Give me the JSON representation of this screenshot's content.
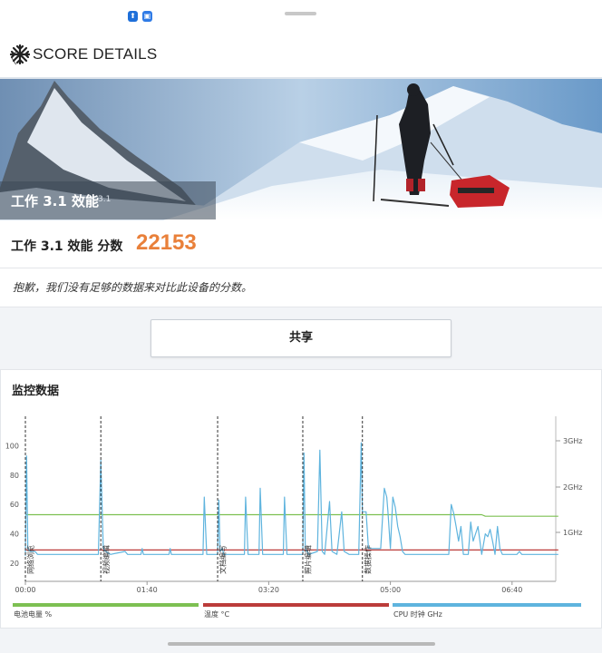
{
  "header": {
    "title": "SCORE DETAILS",
    "back_label": "〈"
  },
  "hero": {
    "benchmark": "工作 3.1 效能",
    "version": "3.1"
  },
  "score": {
    "label": "工作 3.1 效能 分数",
    "value": "22153"
  },
  "note": "抱歉，我们没有足够的数据来对比此设备的分数。",
  "share_label": "共享",
  "monitor": {
    "title": "监控数据"
  },
  "legend": {
    "battery": "电池电量 %",
    "temperature": "温度 °C",
    "cpu": "CPU 时钟 GHz"
  },
  "colors": {
    "accent": "#e9803a",
    "battery": "#7dc052",
    "temperature": "#bb3c3a",
    "cpu": "#5fb4de"
  },
  "chart_data": {
    "type": "line",
    "x_ticks": [
      "00:00",
      "01:40",
      "03:20",
      "05:00",
      "06:40"
    ],
    "x_tick_seconds": [
      0,
      100,
      200,
      300,
      400
    ],
    "y_left_ticks": [
      "20",
      "40",
      "60",
      "80",
      "100"
    ],
    "y_left_range": [
      15,
      105
    ],
    "y_right_ticks": [
      "1GHz",
      "2GHz",
      "3GHz"
    ],
    "grid": false,
    "markers": [
      {
        "t": 0,
        "label": "网络浏览"
      },
      {
        "t": 62,
        "label": "视频编辑"
      },
      {
        "t": 158,
        "label": "文档编写"
      },
      {
        "t": 228,
        "label": "照片编辑"
      },
      {
        "t": 277,
        "label": "数据操作"
      }
    ],
    "series": [
      {
        "name": "电池电量 %",
        "points": [
          [
            0,
            53
          ],
          [
            375,
            53
          ],
          [
            378,
            52
          ],
          [
            438,
            52
          ]
        ]
      },
      {
        "name": "温度 °C",
        "points": [
          [
            0,
            29
          ],
          [
            438,
            29
          ]
        ]
      },
      {
        "name": "CPU 时钟 GHz",
        "points": [
          [
            0,
            25
          ],
          [
            1,
            93
          ],
          [
            2,
            30
          ],
          [
            4,
            28
          ],
          [
            8,
            28
          ],
          [
            10,
            26
          ],
          [
            60,
            26
          ],
          [
            62,
            90
          ],
          [
            64,
            30
          ],
          [
            66,
            28
          ],
          [
            70,
            26
          ],
          [
            82,
            28
          ],
          [
            84,
            26
          ],
          [
            95,
            26
          ],
          [
            96,
            30
          ],
          [
            97,
            26
          ],
          [
            118,
            26
          ],
          [
            119,
            30
          ],
          [
            120,
            26
          ],
          [
            146,
            26
          ],
          [
            147,
            65
          ],
          [
            149,
            26
          ],
          [
            158,
            26
          ],
          [
            159,
            63
          ],
          [
            160,
            28
          ],
          [
            162,
            30
          ],
          [
            163,
            26
          ],
          [
            180,
            26
          ],
          [
            181,
            65
          ],
          [
            183,
            26
          ],
          [
            192,
            26
          ],
          [
            193,
            71
          ],
          [
            195,
            26
          ],
          [
            212,
            26
          ],
          [
            213,
            65
          ],
          [
            215,
            26
          ],
          [
            228,
            26
          ],
          [
            229,
            95
          ],
          [
            230,
            30
          ],
          [
            233,
            26
          ],
          [
            240,
            28
          ],
          [
            242,
            97
          ],
          [
            244,
            28
          ],
          [
            246,
            26
          ],
          [
            250,
            62
          ],
          [
            252,
            28
          ],
          [
            256,
            26
          ],
          [
            260,
            55
          ],
          [
            262,
            28
          ],
          [
            266,
            26
          ],
          [
            274,
            26
          ],
          [
            276,
            102
          ],
          [
            277,
            55
          ],
          [
            280,
            55
          ],
          [
            282,
            30
          ],
          [
            292,
            30
          ],
          [
            295,
            71
          ],
          [
            297,
            65
          ],
          [
            298,
            55
          ],
          [
            300,
            30
          ],
          [
            302,
            65
          ],
          [
            304,
            58
          ],
          [
            306,
            45
          ],
          [
            308,
            38
          ],
          [
            310,
            28
          ],
          [
            312,
            26
          ],
          [
            348,
            26
          ],
          [
            350,
            60
          ],
          [
            352,
            54
          ],
          [
            354,
            45
          ],
          [
            356,
            35
          ],
          [
            358,
            45
          ],
          [
            360,
            26
          ],
          [
            364,
            26
          ],
          [
            366,
            48
          ],
          [
            368,
            35
          ],
          [
            372,
            45
          ],
          [
            375,
            26
          ],
          [
            378,
            40
          ],
          [
            380,
            38
          ],
          [
            382,
            43
          ],
          [
            384,
            35
          ],
          [
            386,
            26
          ],
          [
            388,
            45
          ],
          [
            390,
            30
          ],
          [
            392,
            26
          ],
          [
            400,
            26
          ],
          [
            404,
            26
          ],
          [
            406,
            28
          ],
          [
            408,
            26
          ],
          [
            438,
            26
          ]
        ]
      }
    ]
  }
}
